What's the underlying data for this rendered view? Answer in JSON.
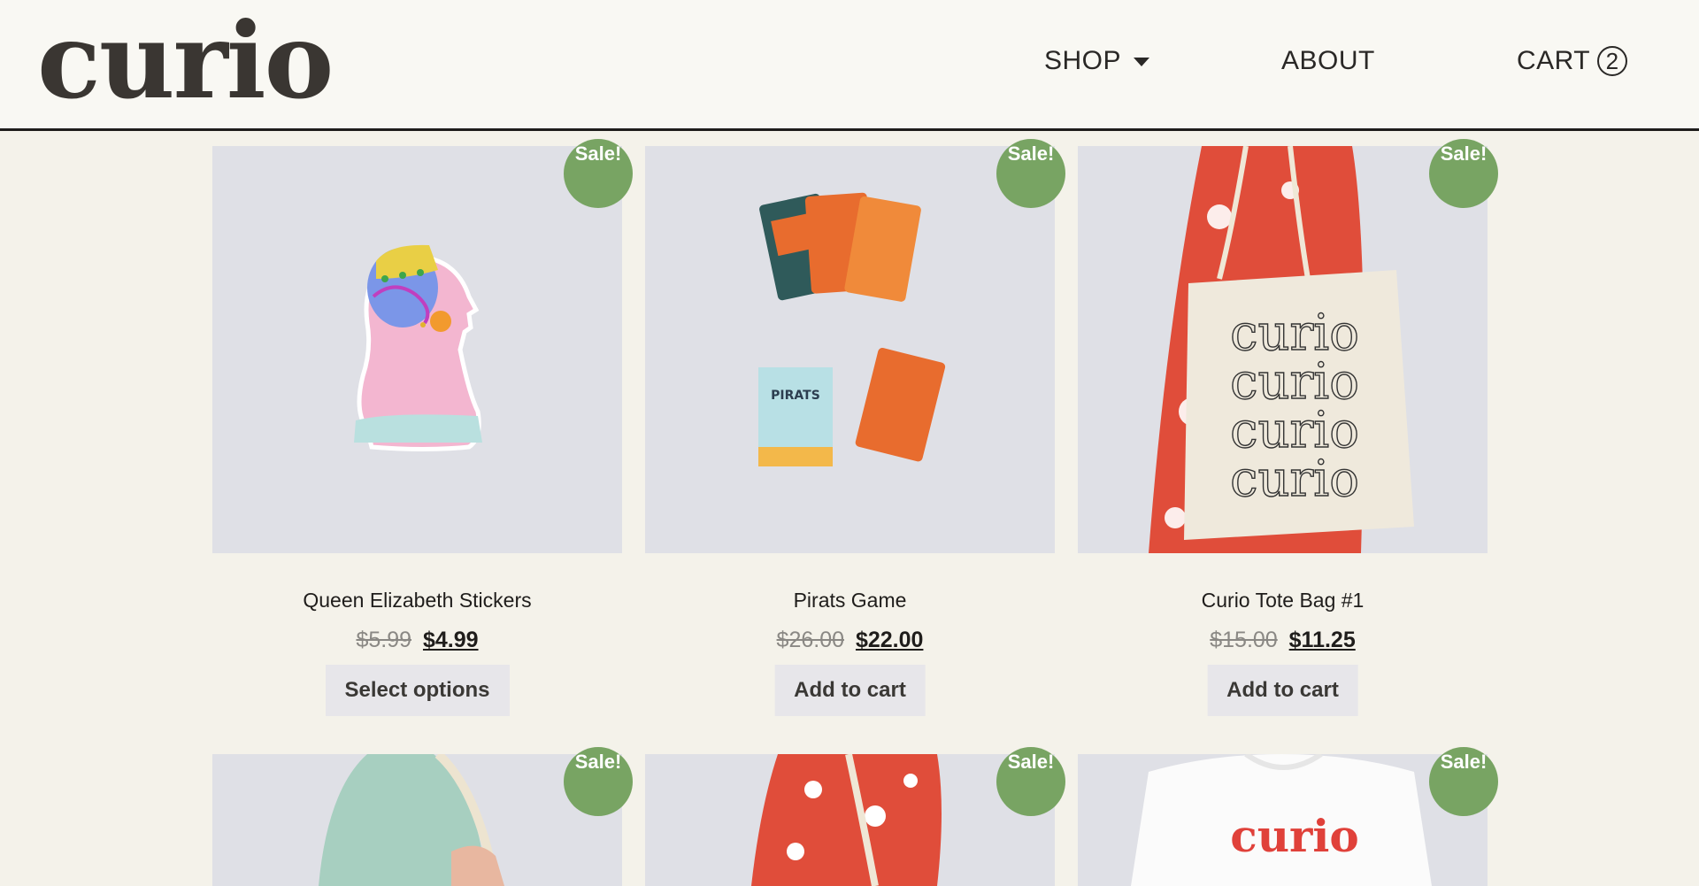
{
  "header": {
    "logo": "curio",
    "nav": {
      "shop": "SHOP",
      "about": "ABOUT",
      "cart": "CART",
      "cart_count": "2"
    }
  },
  "products_row1": [
    {
      "title": "Queen Elizabeth Stickers",
      "old_price": "$5.99",
      "new_price": "$4.99",
      "button": "Select options",
      "badge": "Sale!"
    },
    {
      "title": "Pirats Game",
      "old_price": "$26.00",
      "new_price": "$22.00",
      "button": "Add to cart",
      "badge": "Sale!"
    },
    {
      "title": "Curio Tote Bag #1",
      "old_price": "$15.00",
      "new_price": "$11.25",
      "button": "Add to cart",
      "badge": "Sale!"
    }
  ],
  "products_row2": [
    {
      "badge": "Sale!"
    },
    {
      "badge": "Sale!"
    },
    {
      "badge": "Sale!",
      "shirt_text": "curio"
    }
  ],
  "pirats_box_label": "PIRATS",
  "tote_text": [
    "curio",
    "curio",
    "curio",
    "curio"
  ],
  "colors": {
    "background": "#f4f2ea",
    "header": "#f9f8f3",
    "sale_badge": "#78a463",
    "button_bg": "#e7e6ea",
    "image_bg": "#dfe0e6"
  }
}
